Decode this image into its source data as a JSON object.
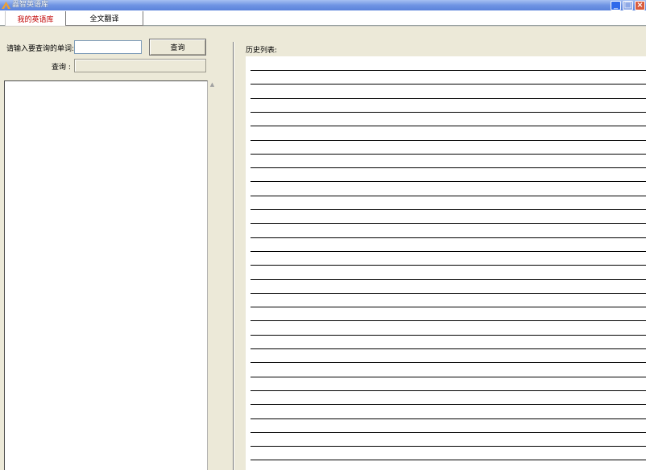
{
  "window": {
    "title": "畾智英语库",
    "controls": {
      "minimize": "_",
      "maximize": "□",
      "close": "×"
    }
  },
  "tabs": [
    {
      "label": "我的英语库",
      "active": true
    },
    {
      "label": "全文翻译",
      "active": false
    }
  ],
  "query_form": {
    "word_label": "请输入要查询的单词:",
    "word_value": "",
    "search_button": "查询",
    "result_label": "查询 :",
    "result_value": ""
  },
  "history": {
    "label": "历史列表:",
    "line_count": 30
  },
  "colors": {
    "title_bar": "#6f94e3",
    "active_tab_text": "#c00000",
    "panel_bg": "#ece9d8"
  }
}
